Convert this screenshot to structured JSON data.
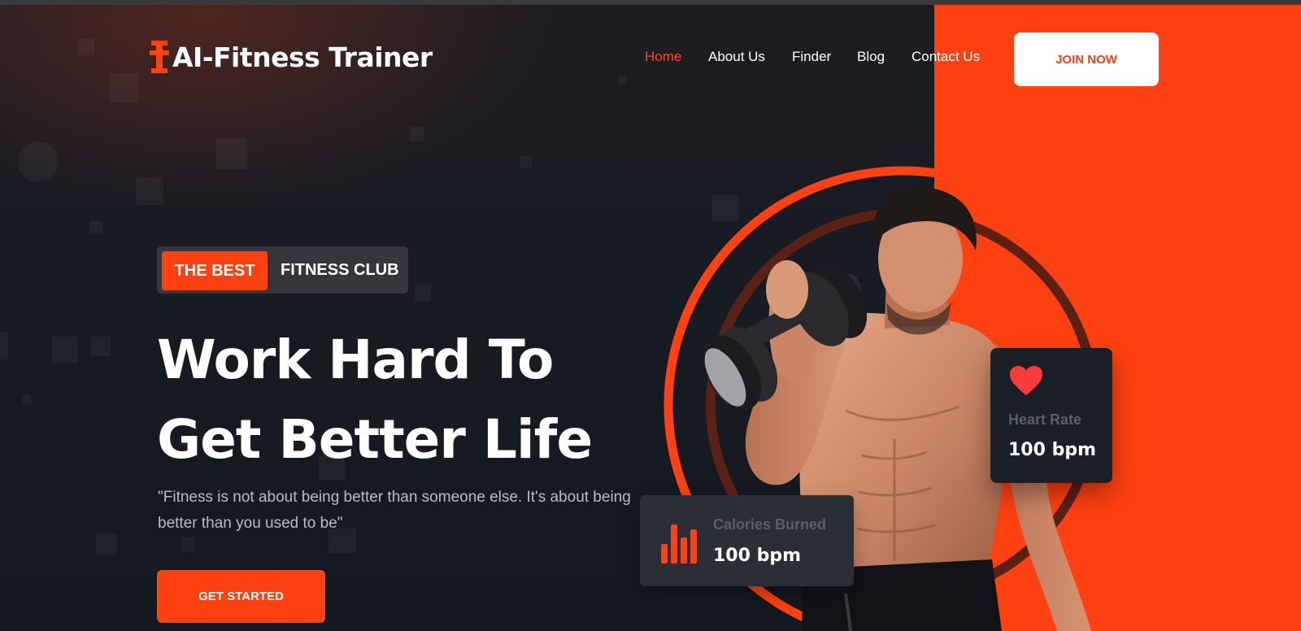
{
  "brand": {
    "name": "AI-Fitness Trainer",
    "logo_icon": "dumbbell-icon",
    "accent_color": "#ff4010"
  },
  "nav": {
    "items": [
      {
        "label": "Home",
        "active": true
      },
      {
        "label": "About Us",
        "active": false
      },
      {
        "label": "Finder",
        "active": false
      },
      {
        "label": "Blog",
        "active": false
      },
      {
        "label": "Contact Us",
        "active": false
      }
    ],
    "join_label": "JOIN NOW"
  },
  "hero": {
    "badge_highlight": "THE BEST",
    "badge_text": "FITNESS CLUB",
    "headline_line1": "Work Hard To",
    "headline_line2": "Get Better Life",
    "quote": "\"Fitness is not about being better than someone else. It's about being better than you used to be\"",
    "cta_label": "GET STARTED"
  },
  "stats": {
    "heart_rate": {
      "label": "Heart Rate",
      "value": "100 bpm",
      "icon": "heart-icon"
    },
    "calories": {
      "label": "Calories Burned",
      "value": "100 bpm",
      "icon": "bar-chart-icon"
    }
  }
}
